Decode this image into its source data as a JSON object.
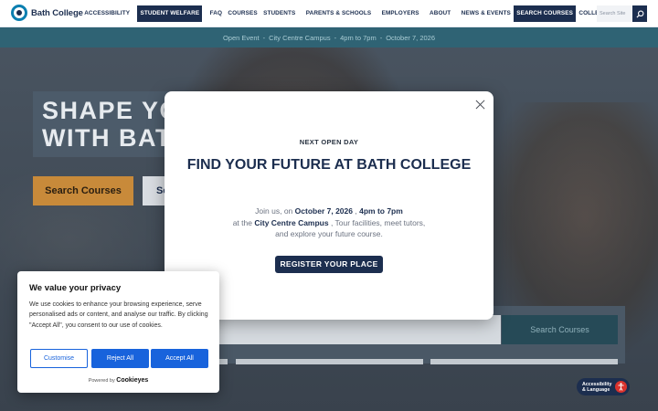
{
  "header": {
    "logo_text": "Bath College",
    "nav": [
      {
        "label": "ACCESSIBILITY"
      },
      {
        "label": "STUDENT WELFARE"
      },
      {
        "label": "FAQ"
      },
      {
        "label": "COURSES"
      },
      {
        "label": "STUDENTS"
      },
      {
        "label": "PARENTS & SCHOOLS"
      },
      {
        "label": "EMPLOYERS"
      },
      {
        "label": "ABOUT"
      },
      {
        "label": "NEWS & EVENTS"
      },
      {
        "label": "SEARCH COURSES"
      },
      {
        "label": "COLLEGE JOBS"
      }
    ],
    "search_placeholder": "Search Site"
  },
  "banner": {
    "event": "Open Event",
    "sep": "-",
    "location": "City Centre Campus",
    "time": "4pm to 7pm",
    "date": "October 7, 2026"
  },
  "hero": {
    "title_line1": "SHAPE YO",
    "title_line2": "WITH BAT",
    "button1": "Search Courses",
    "button2": "Se",
    "course_search_button": "Search Courses"
  },
  "modal": {
    "eyebrow": "NEXT OPEN DAY",
    "title": "FIND YOUR FUTURE AT BATH COLLEGE",
    "body_join": "Join us, on",
    "date": "October 7, 2026",
    "comma": ",",
    "time": "4pm to 7pm",
    "at_the": "at the",
    "campus": "City Centre Campus",
    "body_rest1": ", Tour facilities, meet tutors,",
    "body_rest2": "and explore your future course.",
    "cta": "REGISTER YOUR PLACE"
  },
  "cookie": {
    "title": "We value your privacy",
    "text": "We use cookies to enhance your browsing experience, serve personalised ads or content, and analyse our traffic. By clicking \"Accept All\", you consent to our use of cookies.",
    "customise": "Customise",
    "reject": "Reject All",
    "accept": "Accept All",
    "powered_by": "Powered by",
    "brand": "Cookieyes"
  },
  "a11y_widget": {
    "line1": "Accessibility",
    "line2": "& Language"
  },
  "colors": {
    "navy": "#1c2e4f",
    "teal_banner": "#2f6374",
    "orange": "#c88a3a",
    "cookie_blue": "#1863dc"
  }
}
